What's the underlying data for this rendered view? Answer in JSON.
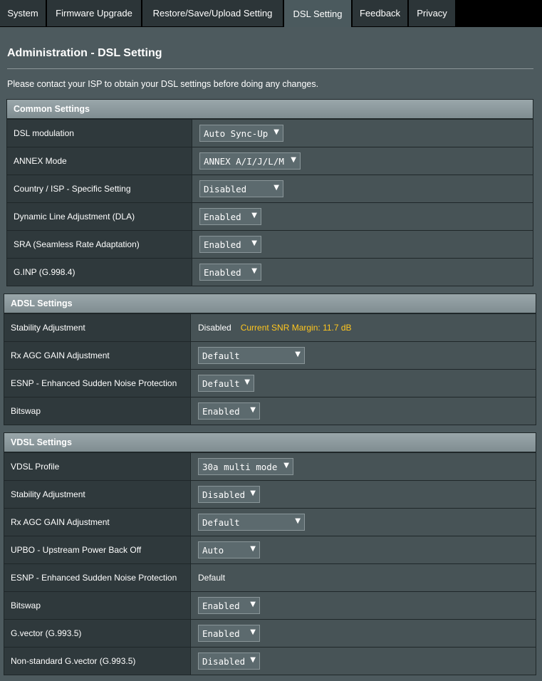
{
  "tabs": [
    {
      "label": "System"
    },
    {
      "label": "Firmware Upgrade"
    },
    {
      "label": "Restore/Save/Upload Setting"
    },
    {
      "label": "DSL Setting",
      "active": true
    },
    {
      "label": "Feedback"
    },
    {
      "label": "Privacy"
    }
  ],
  "page": {
    "title": "Administration - DSL Setting",
    "description": "Please contact your ISP to obtain your DSL settings before doing any changes."
  },
  "common": {
    "header": "Common Settings",
    "rows": [
      {
        "label": "DSL modulation",
        "value": "Auto Sync-Up"
      },
      {
        "label": "ANNEX Mode",
        "value": "ANNEX A/I/J/L/M"
      },
      {
        "label": "Country / ISP - Specific Setting",
        "value": "Disabled"
      },
      {
        "label": "Dynamic Line Adjustment (DLA)",
        "value": "Enabled"
      },
      {
        "label": "SRA (Seamless Rate Adaptation)",
        "value": "Enabled"
      },
      {
        "label": "G.INP (G.998.4)",
        "value": "Enabled"
      }
    ]
  },
  "adsl": {
    "header": "ADSL Settings",
    "rows": [
      {
        "label": "Stability Adjustment",
        "value": "Disabled",
        "snr": "Current SNR Margin: 11.7 dB"
      },
      {
        "label": "Rx AGC GAIN Adjustment",
        "value": "Default"
      },
      {
        "label": "ESNP - Enhanced Sudden Noise Protection",
        "value": "Default"
      },
      {
        "label": "Bitswap",
        "value": "Enabled"
      }
    ]
  },
  "vdsl": {
    "header": "VDSL Settings",
    "rows": [
      {
        "label": "VDSL Profile",
        "value": "30a multi mode"
      },
      {
        "label": "Stability Adjustment",
        "value": "Disabled"
      },
      {
        "label": "Rx AGC GAIN Adjustment",
        "value": "Default"
      },
      {
        "label": "UPBO - Upstream Power Back Off",
        "value": "Auto"
      },
      {
        "label": "ESNP - Enhanced Sudden Noise Protection",
        "value": "Default"
      },
      {
        "label": "Bitswap",
        "value": "Enabled"
      },
      {
        "label": "G.vector (G.993.5)",
        "value": "Enabled"
      },
      {
        "label": "Non-standard G.vector (G.993.5)",
        "value": "Disabled"
      }
    ]
  },
  "icons": {
    "dropdown": "chevron-down-icon"
  },
  "colors": {
    "snr_text": "#ffc61e",
    "header_gradient_top": "#9aa7aa",
    "label_bg": "#2f393c"
  }
}
